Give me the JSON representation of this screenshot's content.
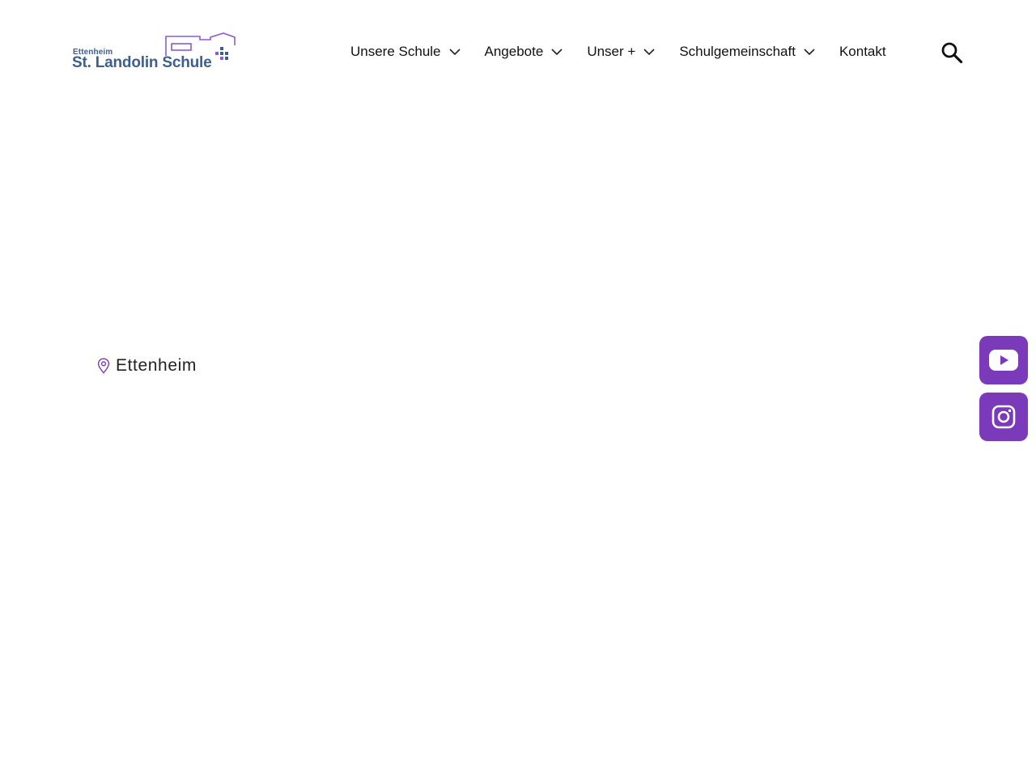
{
  "header": {
    "logo": {
      "small_text": "Ettenheim",
      "main_text": "St. Landolin Schule"
    },
    "nav": [
      {
        "label": "Unsere Schule",
        "has_dropdown": true
      },
      {
        "label": "Angebote",
        "has_dropdown": true
      },
      {
        "label": "Unser +",
        "has_dropdown": true
      },
      {
        "label": "Schulgemeinschaft",
        "has_dropdown": true
      },
      {
        "label": "Kontakt",
        "has_dropdown": false
      }
    ],
    "search_icon": "search-icon"
  },
  "main": {
    "location": {
      "icon": "map-pin-icon",
      "text": "Ettenheim"
    }
  },
  "social": {
    "youtube_icon": "youtube-icon",
    "instagram_icon": "instagram-icon"
  },
  "colors": {
    "accent": "#7a3aba",
    "logo_blue": "#3e5f8a",
    "logo_violet": "#8e5cc8",
    "text": "#111111",
    "background": "#ffffff"
  }
}
